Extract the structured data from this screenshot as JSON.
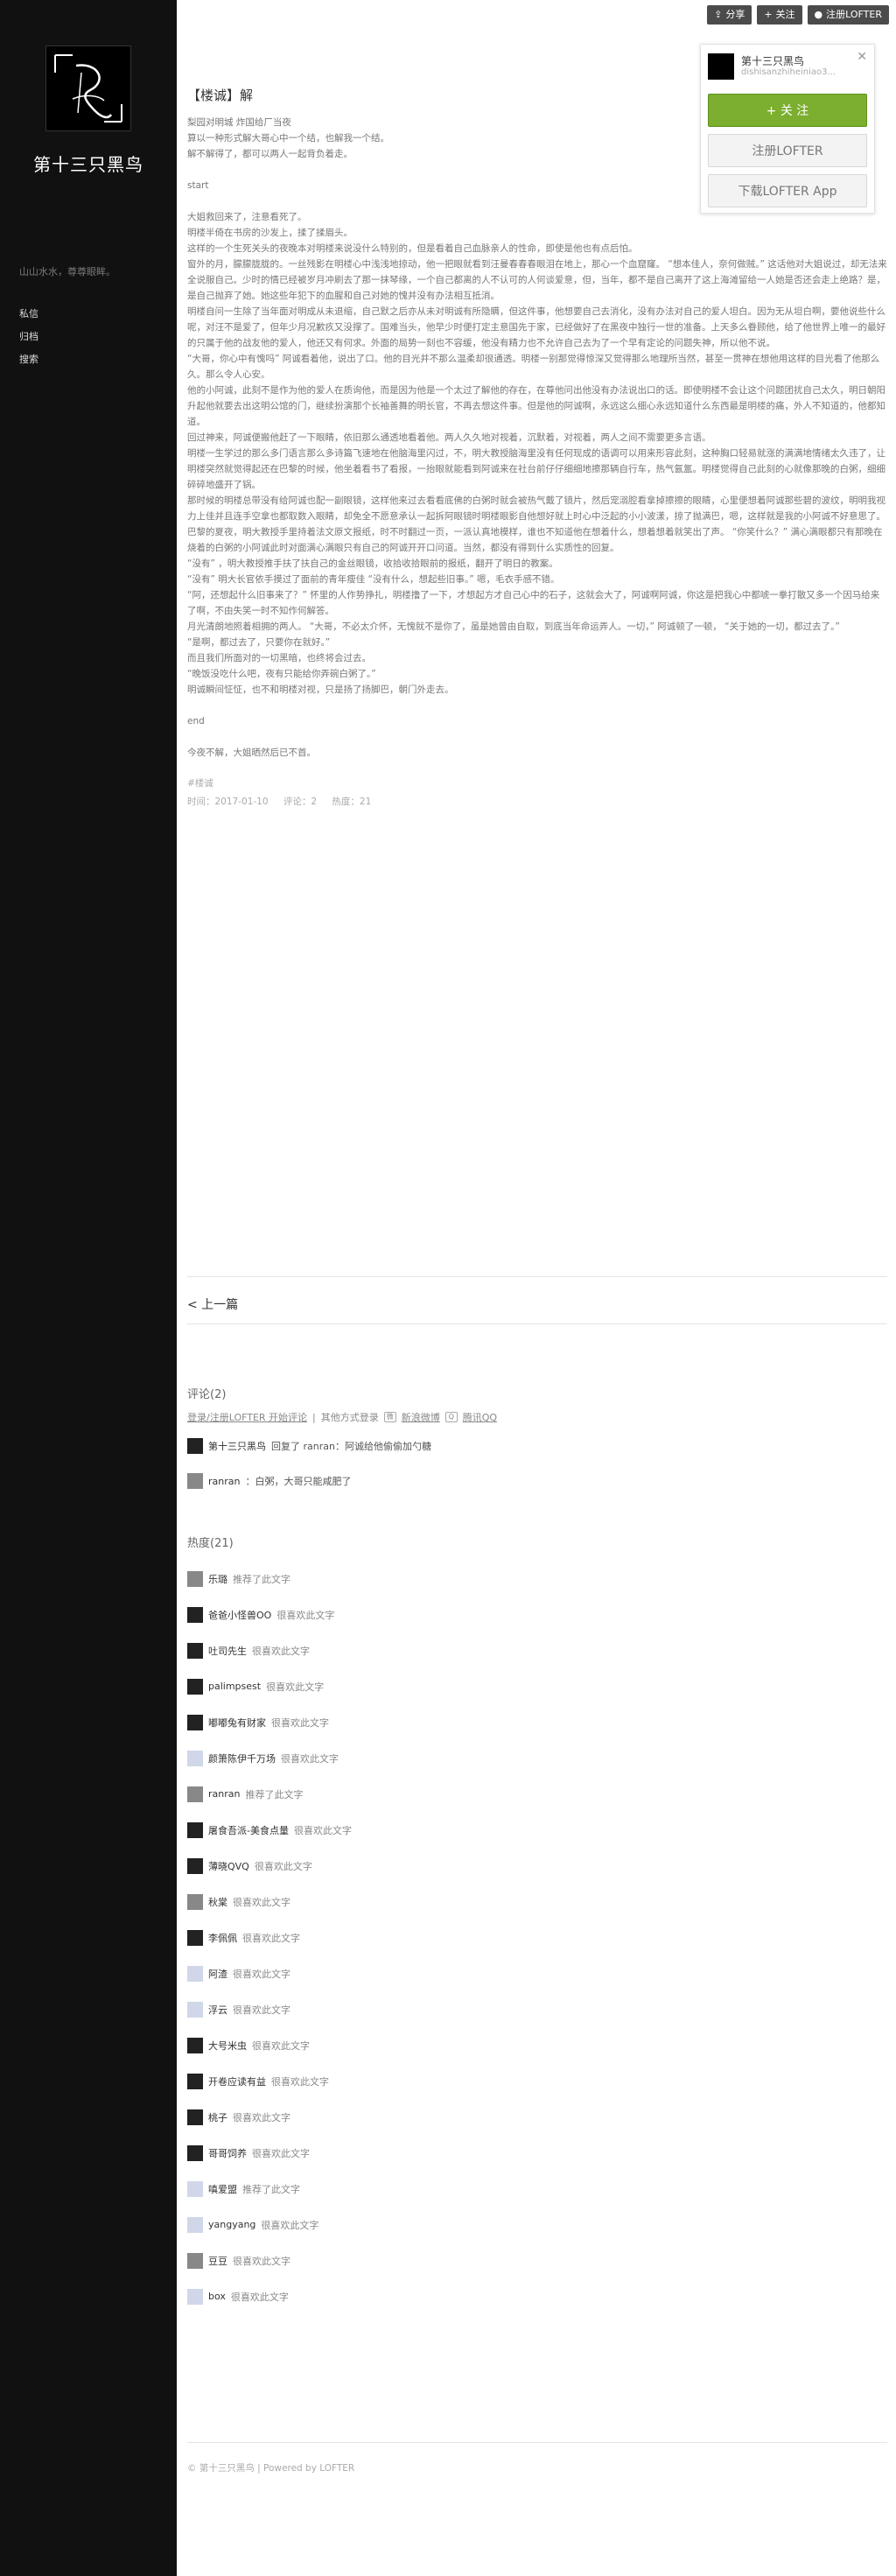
{
  "topbar": {
    "share": "分享",
    "follow": "关注",
    "register": "注册LOFTER"
  },
  "sidebar": {
    "blog_name": "第十三只黑鸟",
    "motto": "山山水水，尊尊眼眸。",
    "nav": [
      "私信",
      "归档",
      "搜索"
    ]
  },
  "post": {
    "title": "【楼诚】解",
    "paragraphs": [
      "梨园对明城 炸国给厂当夜",
      "算以一种形式解大哥心中一个结，也解我一个结。",
      "解不解得了，都可以两人一起背负着走。",
      "start",
      "大姐救回来了，注意看死了。",
      "明楼半倚在书房的沙发上，揉了揉眉头。",
      "这样的一个生死关头的夜晚本对明楼来说没什么特别的，但是看着自己血脉亲人的性命，即使是他也有点后怕。",
      "窗外的月，朦朦胧胧的。一丝残影在明楼心中浅浅地掠动，他一把眼就看到汪曼春春春眼泪在地上，那心一个血窟窿。 “想本佳人，奈何做贼。” 这话他对大姐说过，却无法来全说服自己。少时的情已经被岁月冲刷去了那一抹琴缘，一个自己都离的人不认可的人何谈爱意，但，当年，都不是自己离开了这上海滩留给一人她是否还会走上绝路？是，是自己抛弃了她。她这些年犯下的血腥和自己对她的愧并没有办法相互抵消。",
      "明楼自问一生除了当年面对明成从未退缩，自己默之后亦从未对明诚有所隐瞒，但这件事，他想要自己去消化，没有办法对自己的爱人坦白。因为无从坦白啊，要他说些什么呢，对汪不是爱了，但年少月况歉疚又没撑了。国难当头，他早少时便打定主意国先于家，已经做好了在黑夜中独行一世的准备。上天多么眷顾他，给了他世界上唯一的最好的只属于他的战友他的爱人，他还又有何求。外面的局势一刻也不容缓，他没有精力也不允许自己去为了一个早有定论的问题失神，所以他不说。",
      "“大哥，你心中有愧吗” 阿诚看着他，说出了口。他的目光并不那么温柔却很通透。明楼一别那觉得惊深又觉得那么地理所当然，甚至一贯神在想他用这样的目光看了他那么久。那么令人心安。",
      "他的小阿诚，此刻不是作为他的爱人在质询他，而是因为他是一个太过了解他的存在，在尊他问出他没有办法说出口的话。即使明楼不会让这个问题团扰自己太久，明日朝阳升起他就要去出这明公馆的门，继续扮演那个长袖善舞的明长官，不再去想这件事。但是他的阿诚啊，永远这么细心永远知道什么东西最是明楼的痛，外人不知道的，他都知道。",
      "回过神来，阿诚便搬他赶了一下眼睛，依旧那么通透地看着他。两人久久地对视着，沉默着，对视着，两人之间不需要更多言语。",
      "明楼一生学过的那么多门语言那么多诗篇飞速地在他脑海里闪过，不，明大教授脑海里没有任何现成的语调可以用来形容此刻，这种胸口轻易就涨的满满地情绪太久违了，让明楼突然就觉得起还在巴黎的时候，他坐着看书了看报，一抬眼就能看到阿诚来在社台前仔仔细细地擦那辆自行车，热气氤氲。明楼觉得自己此刻的心就像那晚的白粥，细细碎碎地盛开了锅。",
      "那时候的明楼总带没有给阿诚也配一副眼镜，这样他来过去看看底佛的白粥时就会被热气戴了镜片，然后宠溺腔看拿掉擦擦的眼睛，心里便想着阿诚那些碧的波纹，明明我视力上佳并且连手空拿也都取数入眼睛，却免全不愿意承认一起拆阿眼镜时明楼眼影自他想好就上时心中泛起的小小波漾，掠了抛满巴，嗯，这样就是我的小阿诚不好意思了。",
      "巴黎的夏夜，明大教授手里持着法文原文报纸，时不时翻过一页，一派认真地模样，谁也不知道他在想着什么，想着想着就笑出了声。 “你笑什么？” 满心满眼都只有那晚在烧着的白粥的小阿诚此时对面满心满眼只有自己的阿诚开开口问道。当然，都没有得到什么实质性的回复。",
      "“没有” ，明大教授推手扶了扶自己的金丝眼镜，收拾收拾眼前的报纸，翻开了明日的教案。",
      "“没有” 明大长官依手摸过了面前的青年瘦佳 “没有什么，想起些旧事。” 嗯，毛衣手感不错。",
      "“阿，还想起什么旧事来了？” 怀里的人作势挣扎，明楼撸了一下，才想起方才自己心中的石子，这就会大了，阿诚啊阿诚，你这是把我心中都唬一拳打散又多一个因马给来了啊，不由失笑一时不知作何解答。",
      "月光清朗地照着相拥的两人。 “大哥，不必太介怀，无愧就不是你了，虽是她曾由自取，到底当年命运弄人。一切，” 阿诚顿了一顿， “关于她的一切，都过去了。”",
      "“是啊，都过去了，只要你在就好。”",
      "而且我们所面对的一切黑暗，也终将会过去。",
      "“晚饭没吃什么吧，夜有只能给你弄碗白粥了。”",
      "明诚瞬间怔怔，也不和明楼对视，只是扬了扬脚巴，朝门外走去。",
      "end",
      "今夜不解，大姐晒然后已不首。"
    ],
    "tag": "#楼诚",
    "meta": {
      "time": "时间：2017-01-10",
      "comments": "评论：2",
      "hot": "热度：21"
    }
  },
  "prev_label": "< 上一篇",
  "comments": {
    "title": "评论(2)",
    "login_text": "登录/注册LOFTER 开始评论",
    "other_login": "其他方式登录",
    "sina": "新浪微博",
    "qq": "腾讯QQ",
    "items": [
      {
        "user": "第十三只黑鸟",
        "text": "回复了 ranran：阿诚给他偷偷加勺糖"
      },
      {
        "user": "ranran",
        "text": "：白粥，大哥只能咸肥了"
      }
    ]
  },
  "hot": {
    "title": "热度(21)",
    "items": [
      {
        "user": "乐璐",
        "action": "推荐了此文字"
      },
      {
        "user": "爸爸小怪兽OO",
        "action": "很喜欢此文字"
      },
      {
        "user": "吐司先生",
        "action": "很喜欢此文字"
      },
      {
        "user": "palimpsest",
        "action": "很喜欢此文字"
      },
      {
        "user": "嘟嘟兔有财家",
        "action": "很喜欢此文字"
      },
      {
        "user": "颜箫陈伊千万场",
        "action": "很喜欢此文字"
      },
      {
        "user": "ranran",
        "action": "推荐了此文字"
      },
      {
        "user": "屠食吾派-美食点量",
        "action": "很喜欢此文字"
      },
      {
        "user": "薄晓QVQ",
        "action": "很喜欢此文字"
      },
      {
        "user": "秋棠",
        "action": "很喜欢此文字"
      },
      {
        "user": "李佩佩",
        "action": "很喜欢此文字"
      },
      {
        "user": "阿渣",
        "action": "很喜欢此文字"
      },
      {
        "user": "浮云",
        "action": "很喜欢此文字"
      },
      {
        "user": "大号米虫",
        "action": "很喜欢此文字"
      },
      {
        "user": "开卷应读有益",
        "action": "很喜欢此文字"
      },
      {
        "user": "桃子",
        "action": "很喜欢此文字"
      },
      {
        "user": "哥哥饲养",
        "action": "很喜欢此文字"
      },
      {
        "user": "嗔爱盟",
        "action": "推荐了此文字"
      },
      {
        "user": "yangyang",
        "action": "很喜欢此文字"
      },
      {
        "user": "豆豆",
        "action": "很喜欢此文字"
      },
      {
        "user": "box",
        "action": "很喜欢此文字"
      }
    ]
  },
  "footer": "© 第十三只黑鸟 | Powered by LOFTER",
  "card": {
    "name": "第十三只黑鸟",
    "domain": "dishisanzhiheiniao3...",
    "follow": "+ 关 注",
    "register": "注册LOFTER",
    "download": "下载LOFTER App"
  },
  "colors": {
    "sidebar": "#111111",
    "follow_green": "#7cae2f"
  }
}
